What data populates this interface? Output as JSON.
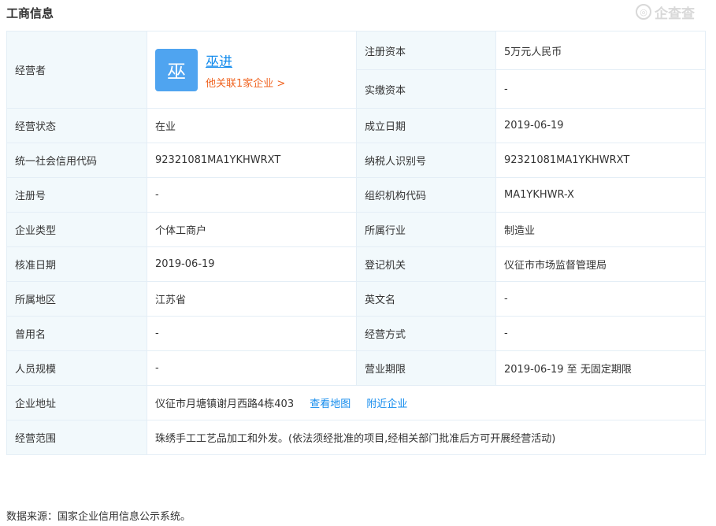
{
  "header": {
    "title": "工商信息",
    "watermark": "企查查",
    "watermark_icon": "q-logo-icon"
  },
  "operator": {
    "label": "经营者",
    "avatar_char": "巫",
    "name": "巫进",
    "related": "他关联1家企业 >",
    "avatar_color": "#4fa4f0"
  },
  "fields": {
    "registered_capital": {
      "label": "注册资本",
      "value": "5万元人民币"
    },
    "paid_capital": {
      "label": "实缴资本",
      "value": "-"
    },
    "status": {
      "label": "经营状态",
      "value": "在业"
    },
    "founded": {
      "label": "成立日期",
      "value": "2019-06-19"
    },
    "credit_code": {
      "label": "统一社会信用代码",
      "value": "92321081MA1YKHWRXT"
    },
    "taxpayer_id": {
      "label": "纳税人识别号",
      "value": "92321081MA1YKHWRXT"
    },
    "reg_no": {
      "label": "注册号",
      "value": "-"
    },
    "org_code": {
      "label": "组织机构代码",
      "value": "MA1YKHWR-X"
    },
    "company_type": {
      "label": "企业类型",
      "value": "个体工商户"
    },
    "industry": {
      "label": "所属行业",
      "value": "制造业"
    },
    "approval_date": {
      "label": "核准日期",
      "value": "2019-06-19"
    },
    "authority": {
      "label": "登记机关",
      "value": "仪征市市场监督管理局"
    },
    "region": {
      "label": "所属地区",
      "value": "江苏省"
    },
    "english_name": {
      "label": "英文名",
      "value": "-"
    },
    "former_name": {
      "label": "曾用名",
      "value": "-"
    },
    "business_mode": {
      "label": "经营方式",
      "value": "-"
    },
    "staff_size": {
      "label": "人员规模",
      "value": "-"
    },
    "business_term": {
      "label": "营业期限",
      "value": "2019-06-19 至 无固定期限"
    },
    "address": {
      "label": "企业地址",
      "value": "仪征市月塘镇谢月西路4栋403",
      "map_link": "查看地图",
      "nearby_link": "附近企业"
    },
    "scope": {
      "label": "经营范围",
      "value": "珠绣手工工艺品加工和外发。(依法须经批准的项目,经相关部门批准后方可开展经营活动)"
    }
  },
  "footer": {
    "source": "数据来源：国家企业信用信息公示系统。"
  },
  "colors": {
    "label_bg": "#f2f9fc",
    "border": "#e4eef6",
    "link": "#128bed",
    "related": "#f06421"
  }
}
